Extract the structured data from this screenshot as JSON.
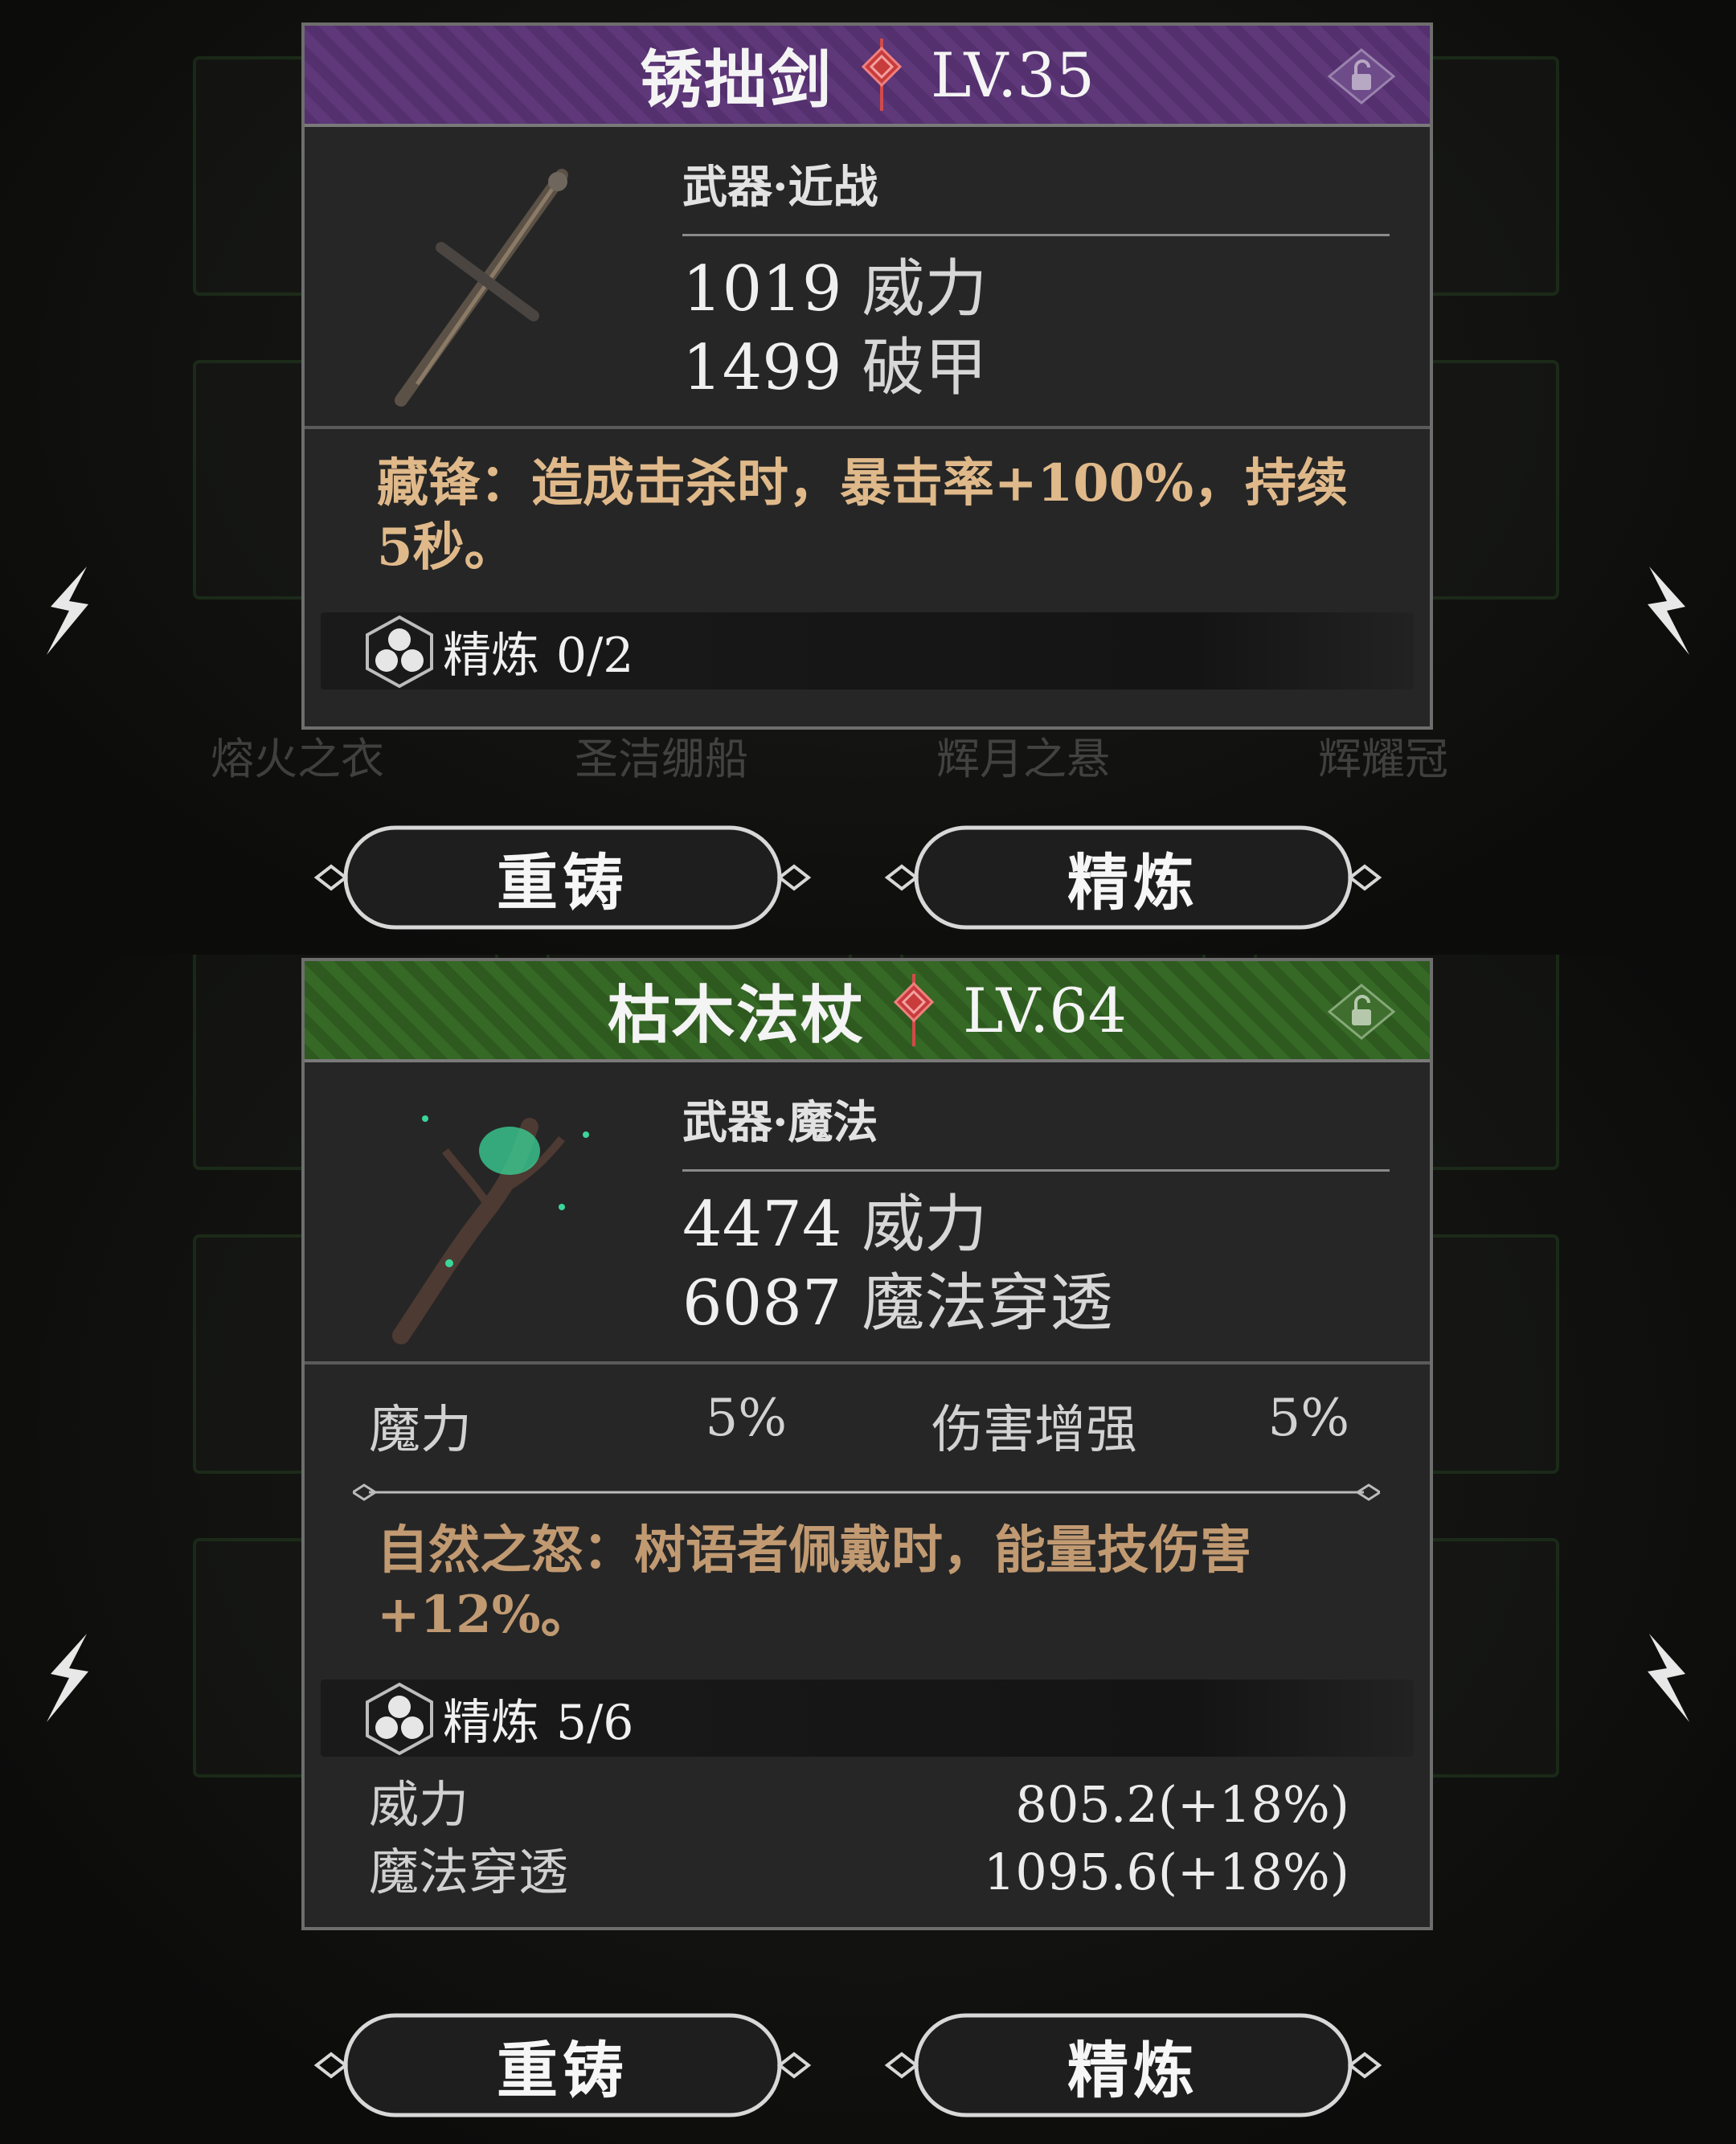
{
  "colors": {
    "purple_header": "#5a3475",
    "green_header": "#336223",
    "effect_text": "#e0b98a",
    "card_bg": "#262626"
  },
  "icons": [
    "arrow-left-icon",
    "arrow-right-icon",
    "chinese-knot-icon",
    "lock-icon",
    "refine-icon",
    "ornament-divider"
  ],
  "background": {
    "names_top": [
      "熔火之衣",
      "圣洁绷船",
      "辉月之悬",
      "辉耀冠"
    ]
  },
  "card1": {
    "name": "锈拙剑",
    "level": "LV.35",
    "category": "武器·近战",
    "stat1_value": "1019",
    "stat1_label": "威力",
    "stat2_value": "1499",
    "stat2_label": "破甲",
    "effect": "藏锋：造成击杀时，暴击率+100%，持续5秒。",
    "refine_label": "精炼",
    "refine_value": "0/2"
  },
  "card2": {
    "name": "枯木法杖",
    "level": "LV.64",
    "category": "武器·魔法",
    "stat1_value": "4474",
    "stat1_label": "威力",
    "stat2_value": "6087",
    "stat2_label": "魔法穿透",
    "attr1_label": "魔力",
    "attr1_value": "5%",
    "attr2_label": "伤害增强",
    "attr2_value": "5%",
    "effect": "自然之怒：树语者佩戴时，能量技伤害+12%。",
    "refine_label": "精炼",
    "refine_value": "5/6",
    "refine_rows": [
      {
        "label": "威力",
        "value": "805.2(+18%)"
      },
      {
        "label": "魔法穿透",
        "value": "1095.6(+18%)"
      }
    ]
  },
  "buttons": {
    "reforge": "重铸",
    "refine": "精炼"
  }
}
